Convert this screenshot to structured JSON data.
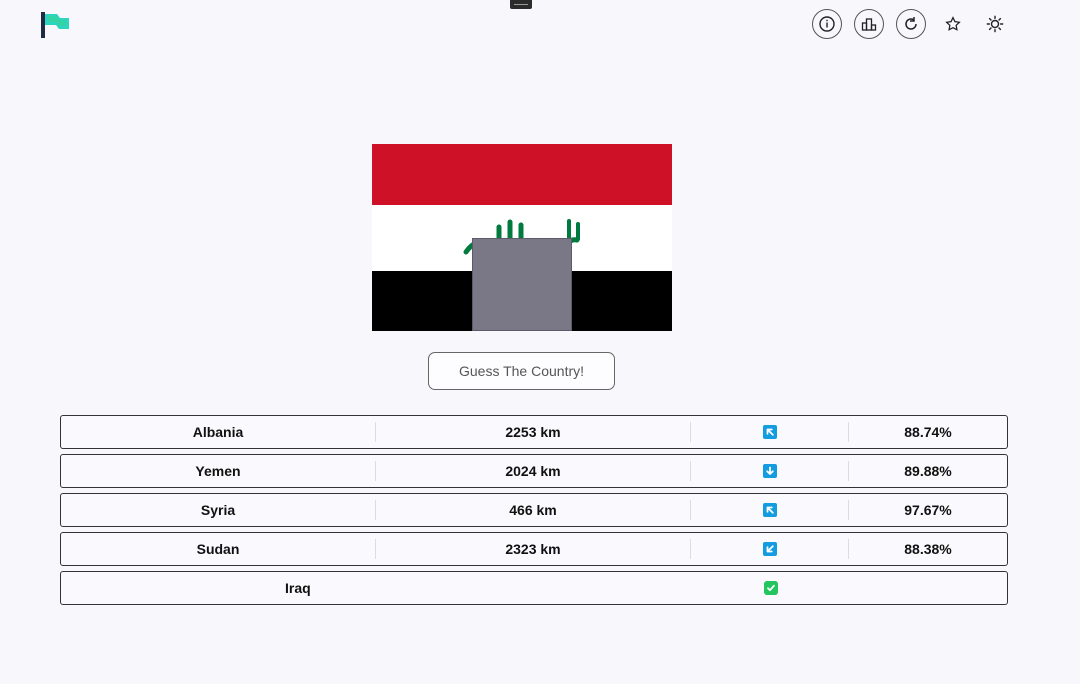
{
  "header": {
    "logo": "flag-logo-icon",
    "icons": [
      "info-icon",
      "leaderboard-icon",
      "refresh-icon",
      "star-icon",
      "sun-icon"
    ]
  },
  "flag": {
    "country": "Iraq",
    "colors": {
      "red": "#ce1126",
      "white": "#ffffff",
      "black": "#000000",
      "green": "#007a3d"
    }
  },
  "guess_button": {
    "label": "Guess The Country!"
  },
  "guesses": [
    {
      "country": "Albania",
      "distance": "2253 km",
      "direction": "up-left-arrow-icon",
      "proximity": "88.74%"
    },
    {
      "country": "Yemen",
      "distance": "2024 km",
      "direction": "down-arrow-icon",
      "proximity": "89.88%"
    },
    {
      "country": "Syria",
      "distance": "466 km",
      "direction": "up-left-arrow-icon",
      "proximity": "97.67%"
    },
    {
      "country": "Sudan",
      "distance": "2323 km",
      "direction": "down-left-arrow-icon",
      "proximity": "88.38%"
    }
  ],
  "answer": {
    "country": "Iraq",
    "status_icon": "check-icon"
  }
}
